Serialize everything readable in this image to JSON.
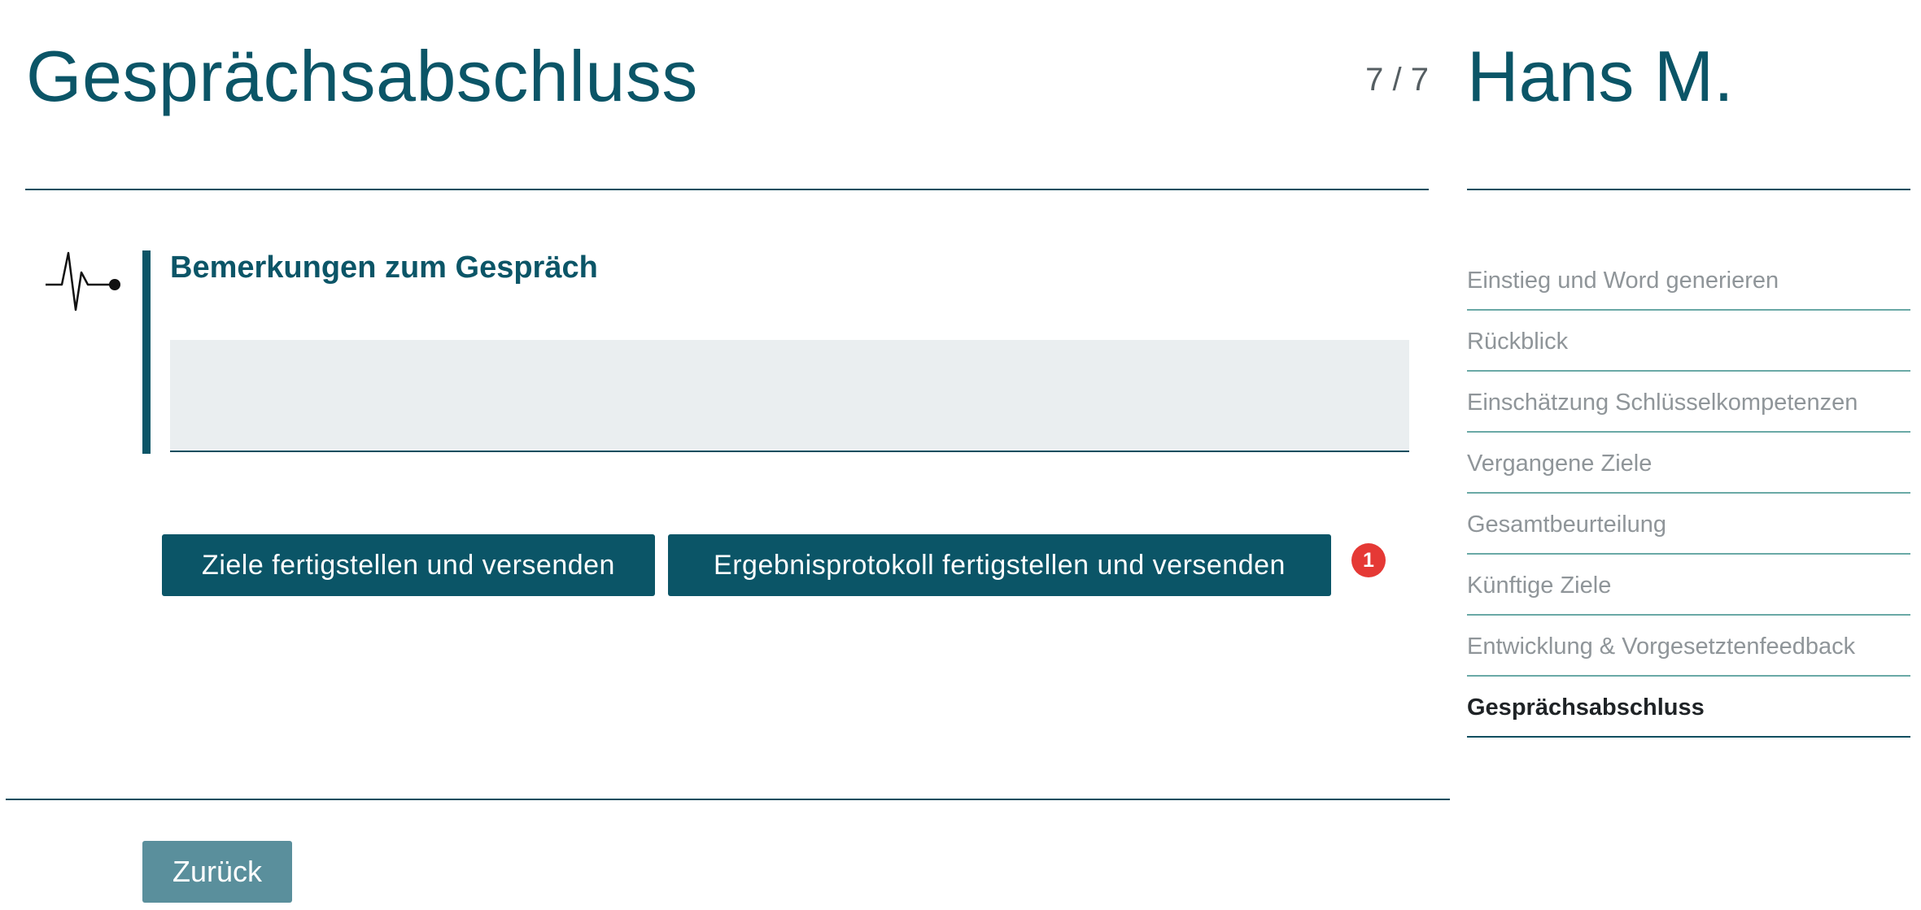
{
  "header": {
    "title": "Gesprächsabschluss",
    "step_counter": "7 / 7",
    "person_name": "Hans M."
  },
  "section": {
    "icon": "heartbeat-icon",
    "title": "Bemerkungen zum Gespräch",
    "remarks_value": ""
  },
  "actions": {
    "goals_button": "Ziele fertigstellen und versenden",
    "protocol_button": "Ergebnisprotokoll fertigstellen und versenden",
    "badge_count": "1",
    "back_button": "Zurück"
  },
  "steps": [
    {
      "label": "Einstieg und Word generieren",
      "active": false
    },
    {
      "label": "Rückblick",
      "active": false
    },
    {
      "label": "Einschätzung Schlüsselkompetenzen",
      "active": false
    },
    {
      "label": "Vergangene Ziele",
      "active": false
    },
    {
      "label": "Gesamtbeurteilung",
      "active": false
    },
    {
      "label": "Künftige Ziele",
      "active": false
    },
    {
      "label": "Entwicklung & Vorgesetztenfeedback",
      "active": false
    },
    {
      "label": "Gesprächsabschluss",
      "active": true
    }
  ],
  "colors": {
    "primary": "#0b5567",
    "back_button": "#5a8f9c",
    "badge": "#e53935",
    "field_bg": "#eaeef0",
    "step_divider": "#6aa9a6"
  }
}
